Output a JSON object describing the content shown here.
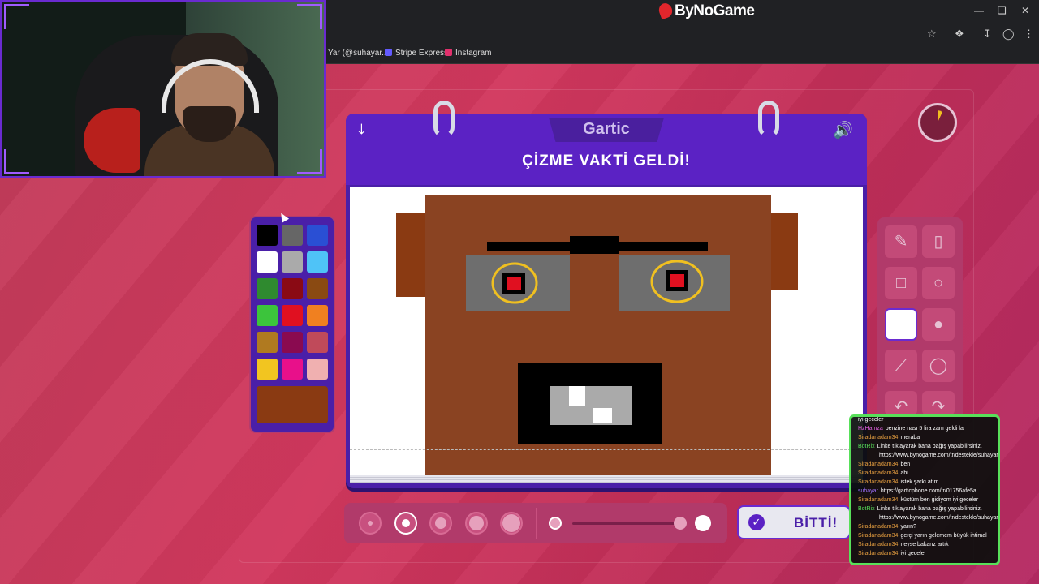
{
  "browser": {
    "brand": "ByNoGame",
    "bookmarks": [
      {
        "label": "Yar (@suhayar...",
        "color": "#ffffff"
      },
      {
        "label": "Stripe Express",
        "color": "#635bff"
      },
      {
        "label": "Instagram",
        "color": "#e1306c"
      }
    ]
  },
  "game": {
    "logo": "Gartic",
    "title": "ÇİZME VAKTİ GELDİ!",
    "done_button": "BİTTİ!",
    "palette": [
      "#000000",
      "#666666",
      "#2a4fd4",
      "#ffffff",
      "#aaaaaa",
      "#4fc3f7",
      "#2f8a2f",
      "#8a0a14",
      "#8a4a12",
      "#3cc43c",
      "#e01020",
      "#f08020",
      "#b07a20",
      "#8a0a50",
      "#c04a5a",
      "#f2c520",
      "#e8108a",
      "#f0b0b0"
    ],
    "selected_color": "#8a3a12",
    "tools": [
      "pencil-icon",
      "eraser-icon",
      "rectangle-outline-icon",
      "ellipse-outline-icon",
      "rectangle-filled-icon",
      "ellipse-filled-icon",
      "line-icon",
      "fill-bucket-icon",
      "undo-icon",
      "redo-icon"
    ],
    "selected_tool": "rectangle-filled-icon",
    "brush_sizes": [
      1,
      2,
      3,
      4,
      5
    ],
    "selected_brush_size": 2,
    "opacity_level": 0.95
  },
  "chat": {
    "messages": [
      {
        "user": "",
        "text": "iyi geceler",
        "color": "#e8a040"
      },
      {
        "user": "HzHamza",
        "text": "benzine nası 5 lira zam geldi la",
        "color": "#e060e0"
      },
      {
        "user": "Siradanadam34",
        "text": "meraba",
        "color": "#e8a040"
      },
      {
        "user": "BotRix",
        "text": "Linke tıklayarak bana bağış yapabilirsiniz.",
        "color": "#58e05a"
      },
      {
        "user": "",
        "text": "https://www.bynogame.com/tr/destekle/suhayar",
        "color": "#58e05a"
      },
      {
        "user": "Siradanadam34",
        "text": "ben",
        "color": "#e8a040"
      },
      {
        "user": "Siradanadam34",
        "text": "abi",
        "color": "#e8a040"
      },
      {
        "user": "Siradanadam34",
        "text": "istek şarkı atım",
        "color": "#e8a040"
      },
      {
        "user": "suhayar",
        "text": "https://garticphone.com/tr/01756afe5a",
        "color": "#a070ff"
      },
      {
        "user": "Siradanadam34",
        "text": "küstüm ben gidiyom iyi geceler",
        "color": "#e8a040"
      },
      {
        "user": "BotRix",
        "text": "Linke tıklayarak bana bağış yapabilirsiniz.",
        "color": "#58e05a"
      },
      {
        "user": "",
        "text": "https://www.bynogame.com/tr/destekle/suhayar",
        "color": "#58e05a"
      },
      {
        "user": "Siradanadam34",
        "text": "yarın?",
        "color": "#e8a040"
      },
      {
        "user": "Siradanadam34",
        "text": "gerçi yarın gelemem büyük ihtimal",
        "color": "#e8a040"
      },
      {
        "user": "Siradanadam34",
        "text": "neyse bakarız artık",
        "color": "#e8a040"
      },
      {
        "user": "Siradanadam34",
        "text": "iyi geceler",
        "color": "#e8a040"
      }
    ]
  }
}
